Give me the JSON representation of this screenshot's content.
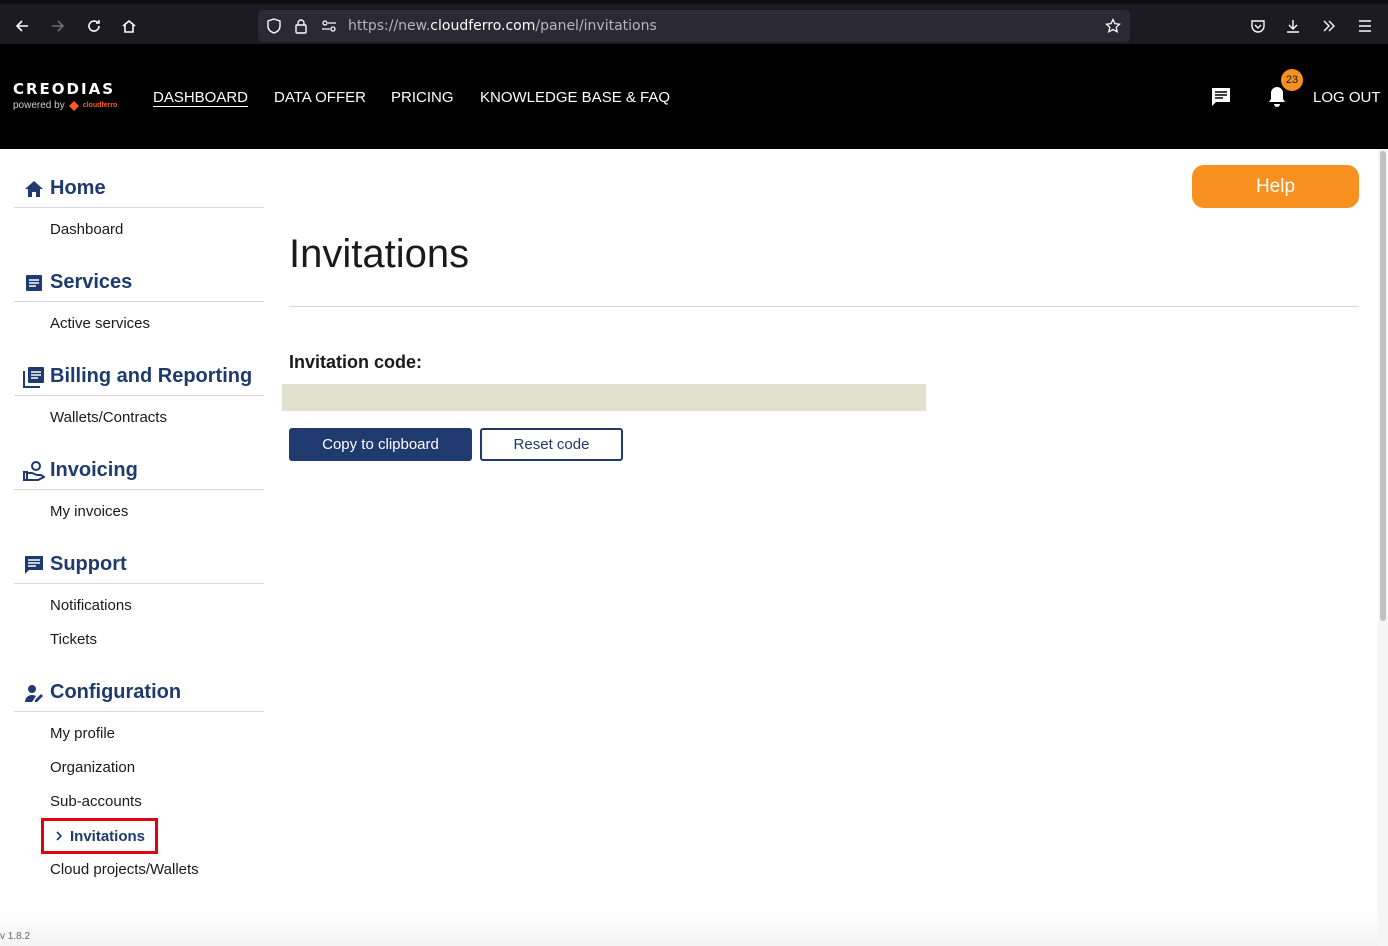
{
  "browser": {
    "url_prefix": "https://new.",
    "url_domain": "cloudferro.com",
    "url_path": "/panel/invitations"
  },
  "header": {
    "logo_text": "CREODIAS",
    "logo_sub": "powered by",
    "logo_brand": "cloudferro",
    "nav": [
      "DASHBOARD",
      "DATA OFFER",
      "PRICING",
      "KNOWLEDGE BASE & FAQ"
    ],
    "notification_count": "23",
    "logout_label": "LOG OUT"
  },
  "sidebar": {
    "sections": [
      {
        "title": "Home",
        "icon": "home-icon",
        "items": [
          "Dashboard"
        ]
      },
      {
        "title": "Services",
        "icon": "services-icon",
        "items": [
          "Active services"
        ]
      },
      {
        "title": "Billing and Reporting",
        "icon": "billing-icon",
        "items": [
          "Wallets/Contracts"
        ]
      },
      {
        "title": "Invoicing",
        "icon": "invoicing-icon",
        "items": [
          "My invoices"
        ]
      },
      {
        "title": "Support",
        "icon": "support-icon",
        "items": [
          "Notifications",
          "Tickets"
        ]
      },
      {
        "title": "Configuration",
        "icon": "configuration-icon",
        "items": [
          "My profile",
          "Organization",
          "Sub-accounts",
          "Invitations",
          "Cloud projects/Wallets"
        ]
      }
    ],
    "active_item": "Invitations"
  },
  "main": {
    "help_label": "Help",
    "page_title": "Invitations",
    "code_label": "Invitation code:",
    "code_value": "",
    "copy_label": "Copy to clipboard",
    "reset_label": "Reset code"
  },
  "version": "v 1.8.2",
  "colors": {
    "accent": "#1f3a6e",
    "help": "#f7901e",
    "highlight": "#e3000f"
  }
}
